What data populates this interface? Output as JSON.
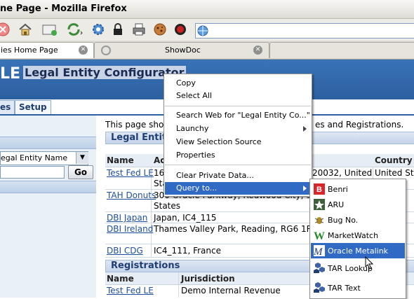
{
  "window": {
    "title": "ne Page - Mozilla Firefox"
  },
  "browser": {
    "tabs": [
      {
        "label": "ies Home Page"
      },
      {
        "label": "ShowDoc"
      }
    ],
    "url": ""
  },
  "app": {
    "logo": "LE",
    "title": "Legal Entity Configurator",
    "nav_tabs": [
      {
        "label": "es"
      },
      {
        "label": "Setup"
      }
    ]
  },
  "sidebar": {
    "search_select_value": "egal Entity Name",
    "go_label": "Go"
  },
  "main": {
    "intro": "This page show",
    "intro_tail": "es and Registrations.",
    "legal_entities": {
      "header": "Legal Entitie",
      "columns": [
        "Name",
        "Ac",
        "Country"
      ],
      "rows": [
        {
          "name": "Test Fed LE",
          "address": "16",
          "address_tail": "20032, United",
          "address_tail2": "State",
          "country": "United Sta"
        },
        {
          "name": "TAH Donuts",
          "address": "300 Oracle Parkway, Redwood City, 9408",
          "address2": "States",
          "country": ""
        },
        {
          "name": "DBI Japan",
          "address": "Japan, IC4_115",
          "country": ""
        },
        {
          "name": "DBI Ireland",
          "address": "Thames Valley Park, Reading, RG6 1RA, U",
          "country": ""
        },
        {
          "name": "DBI CDG",
          "address": "IC4_111, France",
          "country": ""
        }
      ]
    },
    "registrations": {
      "header": "Registrations",
      "columns": [
        "Name",
        "Jurisdiction"
      ],
      "rows": [
        {
          "name": "Test Fed LE",
          "jurisdiction": "Demo Internal Revenue"
        }
      ]
    }
  },
  "context_menu": {
    "items": [
      {
        "label": "Copy"
      },
      {
        "label": "Select All"
      },
      {
        "label": "Search Web for \"Legal Entity Co...\""
      },
      {
        "label": "Launchy"
      },
      {
        "label": "View Selection Source"
      },
      {
        "label": "Properties"
      },
      {
        "label": "Clear Private Data..."
      },
      {
        "label": "Query to..."
      }
    ]
  },
  "submenu": {
    "items": [
      {
        "label": "Benri",
        "icon": "benri-icon"
      },
      {
        "label": "ARU",
        "icon": "aru-icon"
      },
      {
        "label": "Bug No.",
        "icon": "bug-icon"
      },
      {
        "label": "MarketWatch",
        "icon": "marketwatch-icon"
      },
      {
        "label": "Oracle Metalink",
        "icon": "metalink-icon"
      },
      {
        "label": "TAR Lookup",
        "icon": "tar-lookup-icon"
      },
      {
        "label": "TAR Text",
        "icon": "tar-text-icon"
      }
    ]
  },
  "colors": {
    "header_blue": "#2c5f9f",
    "menu_highlight": "#316ac5",
    "link": "#1f4f9a"
  }
}
